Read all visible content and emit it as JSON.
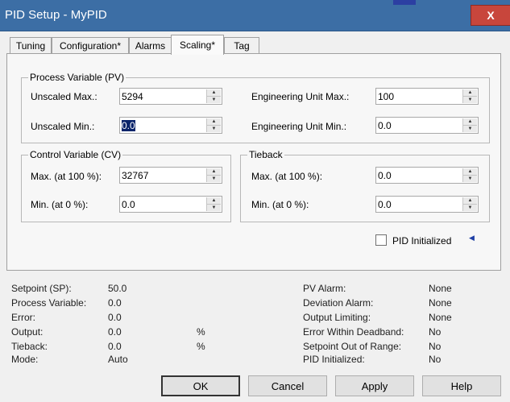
{
  "window": {
    "title": "PID Setup - MyPID",
    "close_label": "X"
  },
  "tabs": [
    {
      "label": "Tuning"
    },
    {
      "label": "Configuration*"
    },
    {
      "label": "Alarms"
    },
    {
      "label": "Scaling*"
    },
    {
      "label": "Tag"
    }
  ],
  "pv_group": {
    "title": "Process Variable (PV)",
    "unscaled_max_label": "Unscaled Max.:",
    "unscaled_max_value": "5294",
    "unscaled_min_label": "Unscaled Min.:",
    "unscaled_min_value": "0.0",
    "eng_max_label": "Engineering Unit Max.:",
    "eng_max_value": "100",
    "eng_min_label": "Engineering Unit Min.:",
    "eng_min_value": "0.0"
  },
  "cv_group": {
    "title": "Control Variable (CV)",
    "max_label": "Max. (at 100 %):",
    "max_value": "32767",
    "min_label": "Min. (at 0 %):",
    "min_value": "0.0"
  },
  "tieback_group": {
    "title": "Tieback",
    "max_label": "Max. (at 100 %):",
    "max_value": "0.0",
    "min_label": "Min. (at 0 %):",
    "min_value": "0.0"
  },
  "pid_initialized_checkbox": {
    "label": "PID Initialized",
    "checked": false
  },
  "status_left": [
    {
      "label": "Setpoint (SP):",
      "value": "50.0",
      "unit": ""
    },
    {
      "label": "Process Variable:",
      "value": "0.0",
      "unit": ""
    },
    {
      "label": "Error:",
      "value": "0.0",
      "unit": ""
    },
    {
      "label": "Output:",
      "value": "0.0",
      "unit": "%"
    },
    {
      "label": "Tieback:",
      "value": "0.0",
      "unit": "%"
    },
    {
      "label": "Mode:",
      "value": "Auto",
      "unit": ""
    }
  ],
  "status_right": [
    {
      "label": "PV Alarm:",
      "value": "None"
    },
    {
      "label": "Deviation Alarm:",
      "value": "None"
    },
    {
      "label": "Output Limiting:",
      "value": "None"
    },
    {
      "label": "Error Within Deadband:",
      "value": "No"
    },
    {
      "label": "Setpoint Out of Range:",
      "value": "No"
    },
    {
      "label": "PID Initialized:",
      "value": "No"
    }
  ],
  "buttons": {
    "ok": "OK",
    "cancel": "Cancel",
    "apply": "Apply",
    "help": "Help"
  },
  "icons": {
    "spin_up": "up-arrow-icon",
    "spin_down": "down-arrow-icon",
    "pid_arrow": "left-arrow-icon"
  },
  "colors": {
    "titlebar": "#3c6ea5",
    "close": "#c8463c",
    "selection": "#0a246a"
  }
}
